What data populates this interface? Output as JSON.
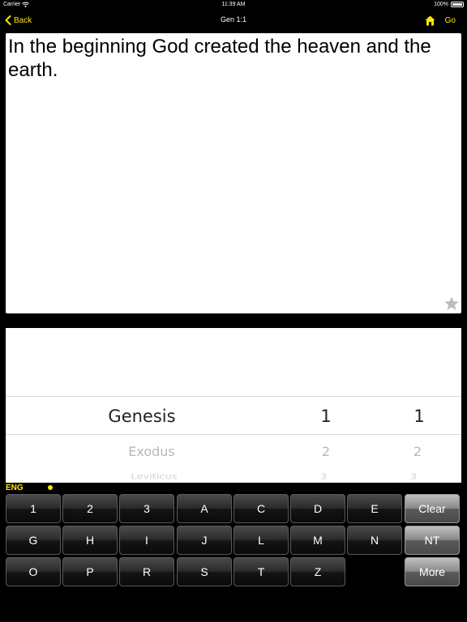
{
  "status_bar": {
    "carrier": "Carrier",
    "time": "11:39 AM",
    "battery": "100%"
  },
  "nav": {
    "back_label": "Back",
    "title": "Gen 1:1",
    "go_label": "Go",
    "accent_color": "#ffe700"
  },
  "verse": {
    "text": "In the beginning God created the heaven and the earth."
  },
  "picker": {
    "selected": {
      "book": "Genesis",
      "chapter": "1",
      "verse": "1"
    },
    "next": {
      "book": "Exodus",
      "chapter": "2",
      "verse": "2"
    },
    "next2": {
      "book": "Leviticus",
      "chapter": "3",
      "verse": "3"
    }
  },
  "language": {
    "label": "ENG"
  },
  "keyboard": {
    "row1": [
      "1",
      "2",
      "3",
      "A",
      "C",
      "D",
      "E"
    ],
    "row2": [
      "G",
      "H",
      "I",
      "J",
      "L",
      "M",
      "N"
    ],
    "row3": [
      "O",
      "P",
      "R",
      "S",
      "T",
      "Z"
    ],
    "clear_label": "Clear",
    "nt_label": "NT",
    "more_label": "More"
  }
}
